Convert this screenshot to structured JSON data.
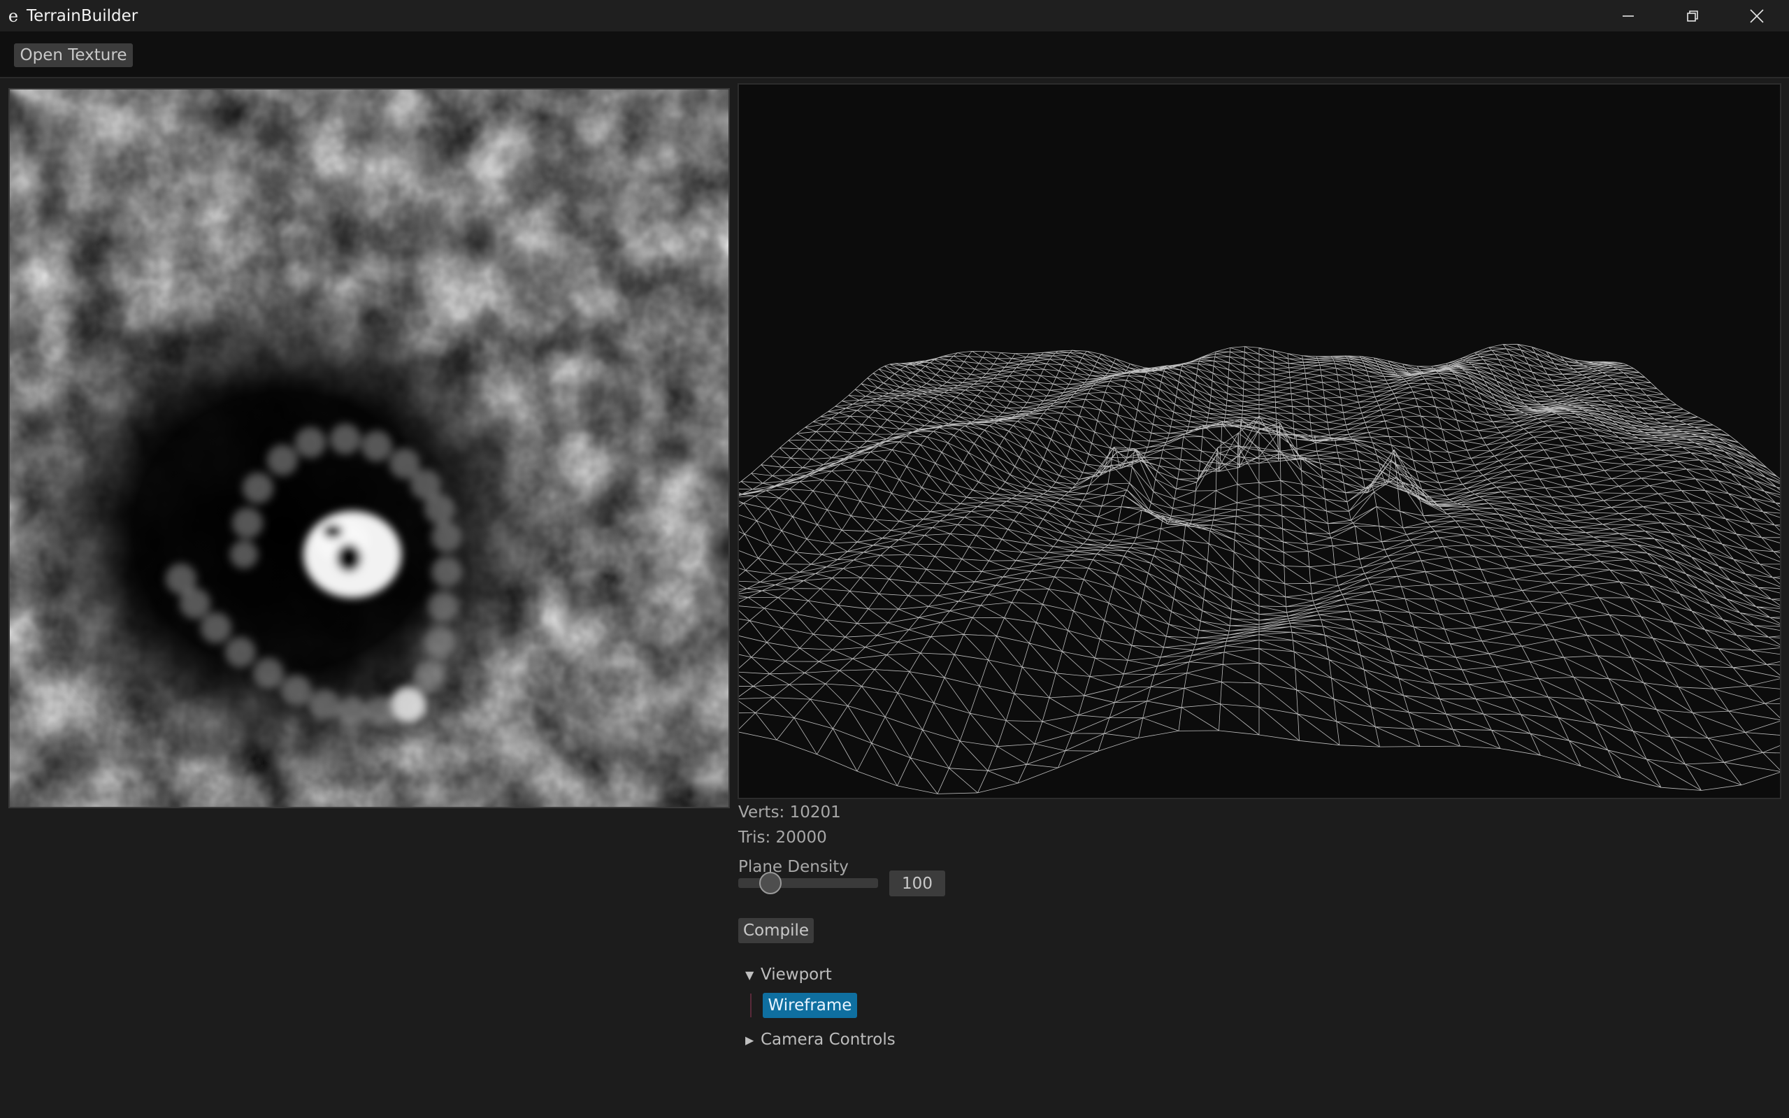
{
  "window": {
    "title": "TerrainBuilder",
    "app_icon_glyph": "e"
  },
  "toolbar": {
    "open_texture_label": "Open Texture"
  },
  "stats": {
    "verts": "Verts: 10201",
    "tris": "Tris: 20000"
  },
  "plane_density": {
    "label": "Plane Density",
    "value": "100",
    "slider_fraction": 0.12
  },
  "compile_label": "Compile",
  "tree": {
    "viewport": {
      "label": "Viewport",
      "expanded": true,
      "child": "Wireframe"
    },
    "camera_controls": {
      "label": "Camera Controls",
      "expanded": false
    }
  },
  "colors": {
    "accent": "#0f6fa0",
    "background": "#1c1c1c",
    "titlebar": "#1f1f1f"
  },
  "icons": [
    "minimize-icon",
    "restore-icon",
    "close-icon",
    "triangle-down-icon",
    "triangle-right-icon"
  ]
}
